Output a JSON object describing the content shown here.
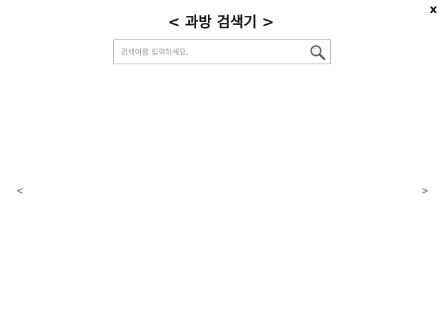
{
  "header": {
    "title": "< 과방 검색기 >",
    "close_label": "x"
  },
  "search": {
    "value": "",
    "placeholder": "검색어를 입력하세요.",
    "icon": "search-icon"
  },
  "navigation": {
    "prev_label": "<",
    "next_label": ">"
  },
  "colors": {
    "background": "#ffffff",
    "text": "#111111",
    "border": "#b5b5b5",
    "placeholder": "#9a9a9a",
    "arrow": "#8a8a8a"
  }
}
